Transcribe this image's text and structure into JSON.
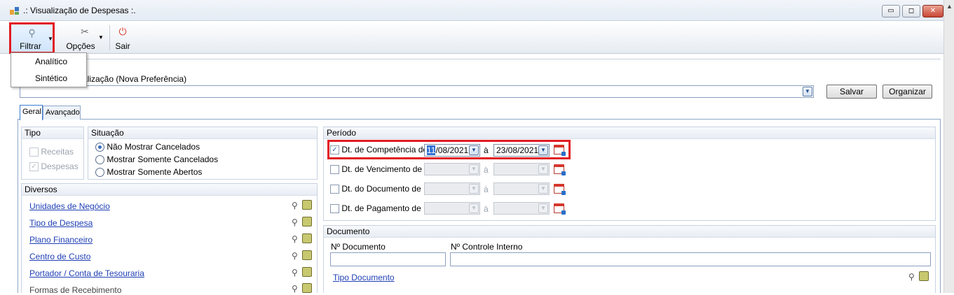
{
  "window": {
    "title": ".: Visualização de Despesas :.",
    "controls": [
      "▭",
      "◻",
      "✕"
    ]
  },
  "toolbar": {
    "filtrar": "Filtrar",
    "opcoes": "Opções",
    "sair": "Sair",
    "menu": [
      "Analítico",
      "Sintético"
    ]
  },
  "preferences": {
    "label": "alização (Nova Preferência)",
    "salvar": "Salvar",
    "organizar": "Organizar"
  },
  "tabs": [
    "Geral",
    "Avançado"
  ],
  "tipo": {
    "title": "Tipo",
    "options": [
      {
        "label": "Receitas",
        "checked": false
      },
      {
        "label": "Despesas",
        "checked": true
      }
    ]
  },
  "situacao": {
    "title": "Situação",
    "options": [
      {
        "label": "Não Mostrar Cancelados",
        "selected": true
      },
      {
        "label": "Mostrar Somente Cancelados",
        "selected": false
      },
      {
        "label": "Mostrar Somente Abertos",
        "selected": false
      }
    ]
  },
  "diversos": {
    "title": "Diversos",
    "items": [
      "Unidades de Negócio",
      "Tipo de Despesa",
      "Plano Financeiro",
      "Centro de Custo",
      "Portador / Conta de Tesouraria",
      "Formas de Recebimento"
    ]
  },
  "periodo": {
    "title": "Período",
    "separator": "à",
    "rows": [
      {
        "label": "Dt. de Competência de",
        "checked": true,
        "from_sel": "11",
        "from_rest": "/08/2021",
        "to": "23/08/2021"
      },
      {
        "label": "Dt. de Vencimento de",
        "checked": false
      },
      {
        "label": "Dt. do Documento de",
        "checked": false
      },
      {
        "label": "Dt. de Pagamento de",
        "checked": false
      }
    ]
  },
  "documento": {
    "title": "Documento",
    "num_label": "Nº Documento",
    "controle_label": "Nº Controle Interno",
    "tipo_link": "Tipo Documento"
  }
}
